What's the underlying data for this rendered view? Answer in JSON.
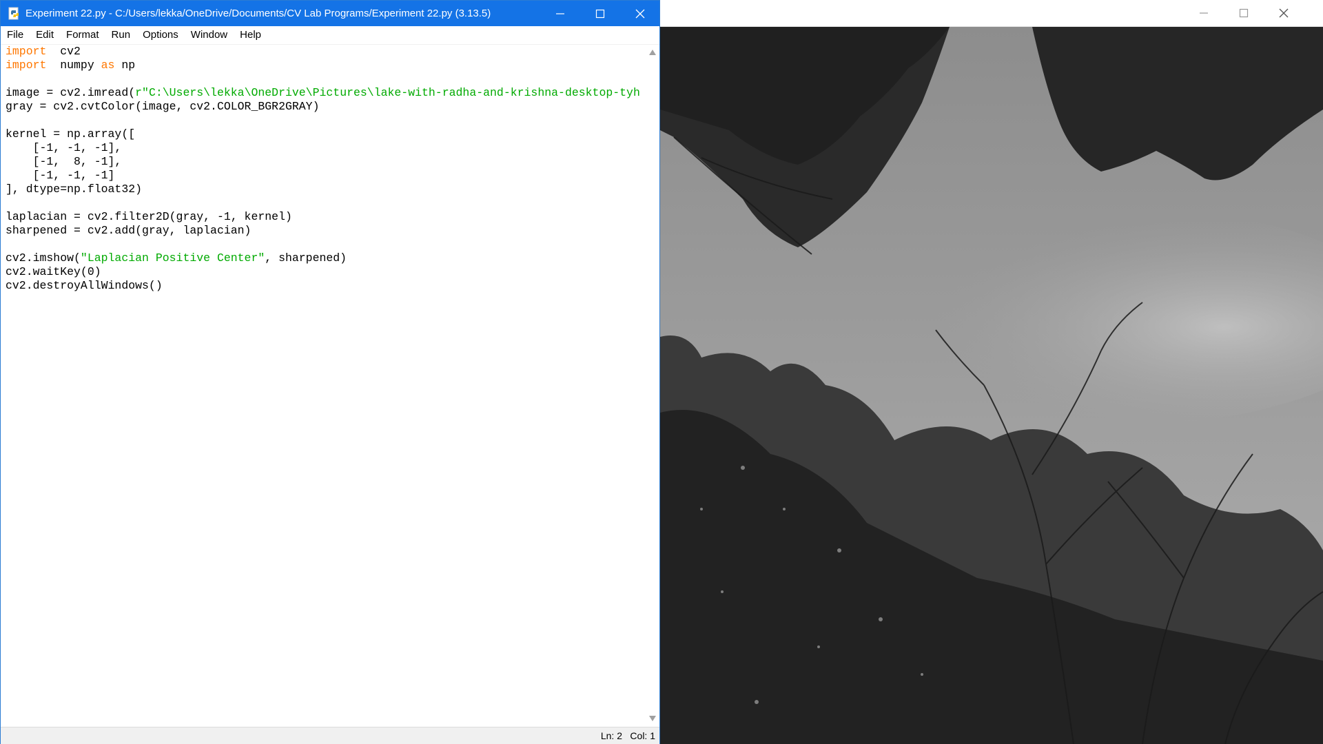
{
  "idle": {
    "title": "Experiment 22.py - C:/Users/lekka/OneDrive/Documents/CV Lab Programs/Experiment 22.py (3.13.5)",
    "menu": [
      "File",
      "Edit",
      "Format",
      "Run",
      "Options",
      "Window",
      "Help"
    ],
    "code_lines": [
      [
        [
          "kw",
          "import"
        ],
        [
          "",
          "  cv2"
        ]
      ],
      [
        [
          "kw",
          "import"
        ],
        [
          "",
          "  numpy "
        ],
        [
          "kw",
          "as"
        ],
        [
          "",
          " np"
        ]
      ],
      [],
      [
        [
          "",
          "image = cv2.imread("
        ],
        [
          "str",
          "r\"C:\\Users\\lekka\\OneDrive\\Pictures\\lake-with-radha-and-krishna-desktop-tyh"
        ]
      ],
      [
        [
          "",
          "gray = cv2.cvtColor(image, cv2.COLOR_BGR2GRAY)"
        ]
      ],
      [],
      [
        [
          "",
          "kernel = np.array(["
        ]
      ],
      [
        [
          "",
          "    [-1, -1, -1],"
        ]
      ],
      [
        [
          "",
          "    [-1,  8, -1],"
        ]
      ],
      [
        [
          "",
          "    [-1, -1, -1]"
        ]
      ],
      [
        [
          "",
          "], dtype=np.float32)"
        ]
      ],
      [],
      [
        [
          "",
          "laplacian = cv2.filter2D(gray, -1, kernel)"
        ]
      ],
      [
        [
          "",
          "sharpened = cv2.add(gray, laplacian)"
        ]
      ],
      [],
      [
        [
          "",
          "cv2.imshow("
        ],
        [
          "str",
          "\"Laplacian Positive Center\""
        ],
        [
          "",
          ", sharpened)"
        ]
      ],
      [
        [
          "",
          "cv2.waitKey(0)"
        ]
      ],
      [
        [
          "",
          "cv2.destroyAllWindows()"
        ]
      ]
    ],
    "status": {
      "line": "Ln: 2",
      "col": "Col: 1"
    },
    "colors": {
      "titlebar": "#1473e6",
      "keyword": "#ff7700",
      "string": "#00aa00"
    }
  },
  "cv_window": {
    "title": "",
    "image_description_icon": "grayscale-sharpened-trees-image"
  }
}
